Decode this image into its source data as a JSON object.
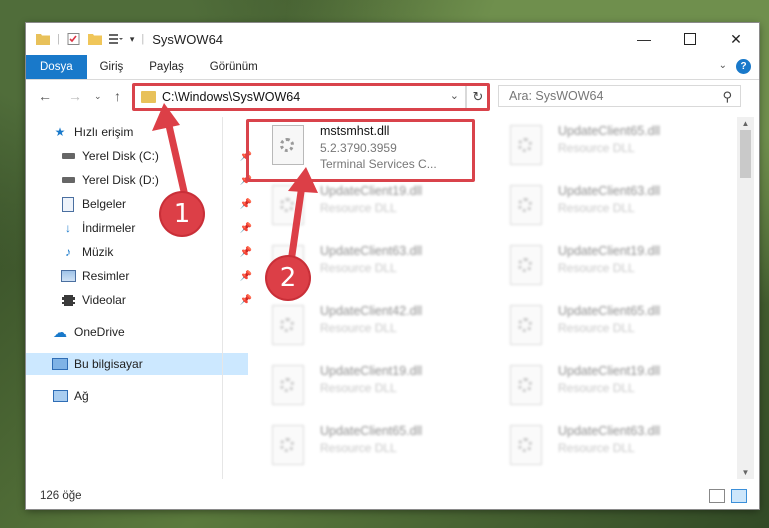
{
  "window": {
    "title": "SysWOW64"
  },
  "ribbon": {
    "tabs": [
      "Dosya",
      "Giriş",
      "Paylaş",
      "Görünüm"
    ],
    "help": "?"
  },
  "address": {
    "path": "C:\\Windows\\SysWOW64"
  },
  "search": {
    "placeholder": "Ara: SysWOW64"
  },
  "nav": {
    "quick_access": "Hızlı erişim",
    "items": [
      "Yerel Disk (C:)",
      "Yerel Disk (D:)",
      "Belgeler",
      "İndirmeler",
      "Müzik",
      "Resimler",
      "Videolar"
    ],
    "onedrive": "OneDrive",
    "this_pc": "Bu bilgisayar",
    "network": "Ağ"
  },
  "highlighted_file": {
    "name": "mstsmhst.dll",
    "version": "5.2.3790.3959",
    "description": "Terminal Services C..."
  },
  "files": [
    {
      "name": "UpdateClient65.dll",
      "type": "Resource DLL"
    },
    {
      "name": "UpdateClient19.dll",
      "type": "Resource DLL"
    },
    {
      "name": "UpdateClient63.dll",
      "type": "Resource DLL"
    },
    {
      "name": "UpdateClient63.dll",
      "type": "Resource DLL"
    },
    {
      "name": "UpdateClient19.dll",
      "type": "Resource DLL"
    },
    {
      "name": "UpdateClient42.dll",
      "type": "Resource DLL"
    },
    {
      "name": "UpdateClient65.dll",
      "type": "Resource DLL"
    },
    {
      "name": "UpdateClient19.dll",
      "type": "Resource DLL"
    },
    {
      "name": "UpdateClient19.dll",
      "type": "Resource DLL"
    },
    {
      "name": "UpdateClient65.dll",
      "type": "Resource DLL"
    },
    {
      "name": "UpdateClient63.dll",
      "type": "Resource DLL"
    }
  ],
  "status": {
    "count": "126 öğe"
  },
  "callouts": {
    "one": "1",
    "two": "2"
  },
  "colors": {
    "accent": "#1979ca",
    "highlight": "#d9434b",
    "selected": "#cce8ff"
  }
}
